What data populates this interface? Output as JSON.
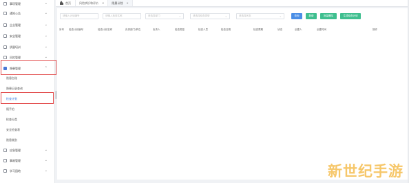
{
  "sidebar": {
    "menus": [
      {
        "label": "事项管理",
        "icon": "doc-icon"
      },
      {
        "label": "通知公告",
        "icon": "bell-icon"
      },
      {
        "label": "企业管理",
        "icon": "building-icon"
      },
      {
        "label": "安全管理",
        "icon": "shield-icon"
      },
      {
        "label": "质量培训",
        "icon": "book-icon"
      },
      {
        "label": "风险管理",
        "icon": "warning-icon"
      },
      {
        "label": "隐患管理",
        "icon": "folder-icon"
      }
    ],
    "sub_items": [
      {
        "label": "隐患台账"
      },
      {
        "label": "隐患记录查询"
      },
      {
        "label": "检查计划"
      },
      {
        "label": "随手拍"
      },
      {
        "label": "检查分类"
      },
      {
        "label": "安全检查表"
      },
      {
        "label": "隐患类别"
      }
    ],
    "bottom_menus": [
      {
        "label": "应急管理",
        "icon": "alarm-icon"
      },
      {
        "label": "事故管理",
        "icon": "report-icon"
      },
      {
        "label": "学习园地",
        "icon": "study-icon"
      }
    ],
    "active_sub": "检查计划"
  },
  "tabs": [
    {
      "label": "首页",
      "icon": "home-icon",
      "closable": false
    },
    {
      "label": "风险辨识和评价",
      "closable": true
    },
    {
      "label": "隐患计划",
      "closable": true
    }
  ],
  "filters": {
    "fields": [
      {
        "placeholder": "请输入计划编号",
        "type": "text"
      },
      {
        "placeholder": "请输入检查名称",
        "type": "text"
      },
      {
        "placeholder": "请选择部门",
        "type": "select"
      },
      {
        "placeholder": "请选择检查类型",
        "type": "select"
      },
      {
        "placeholder": "请选择状态",
        "type": "select"
      }
    ],
    "buttons": [
      {
        "label": "查询",
        "color": "#4a8ee6"
      },
      {
        "label": "新增",
        "color": "#3fbf8f"
      },
      {
        "label": "批量删除",
        "color": "#3fbf8f"
      },
      {
        "label": "生成检查计划",
        "color": "#3fbf8f"
      }
    ]
  },
  "table": {
    "columns": [
      "序号",
      "检查计划编号",
      "检查计划名称",
      "负责部门/单位",
      "负责人",
      "检查类型",
      "检查人员",
      "检查日期",
      "检查周期",
      "状态",
      "创建人",
      "创建时间",
      "操作"
    ]
  },
  "watermark": "新世纪手游",
  "colors": {
    "accent": "#3b7be0",
    "highlight_box": "#e24b4b",
    "primary_button": "#4a8ee6",
    "secondary_button": "#3fbf8f"
  }
}
